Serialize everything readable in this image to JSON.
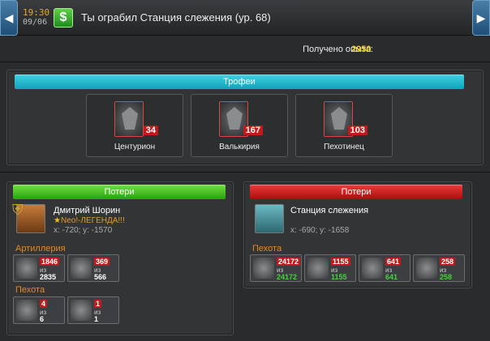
{
  "header": {
    "time": "19:30",
    "date": "09/06",
    "title": "Ты ограбил Станция слежения (ур. 68)",
    "money_icon": "$"
  },
  "experience": {
    "label": "Получено опыта:",
    "value": "2950"
  },
  "trophies": {
    "title": "Трофеи",
    "items": [
      {
        "name": "Центурион",
        "count": "34"
      },
      {
        "name": "Валькирия",
        "count": "167"
      },
      {
        "name": "Пехотинец",
        "count": "103"
      }
    ]
  },
  "left_losses": {
    "title": "Потери",
    "player_name": "Дмитрий Шорин",
    "alliance": "Neo!-ЛЕГЕНДА!!!",
    "coords": "x: -720; y: -1570",
    "sections": [
      {
        "label": "Артиллерия",
        "units": [
          {
            "lost": "1846",
            "iz": "из",
            "total": "2835"
          },
          {
            "lost": "369",
            "iz": "из",
            "total": "566"
          }
        ]
      },
      {
        "label": "Пехота",
        "units": [
          {
            "lost": "4",
            "iz": "из",
            "total": "6"
          },
          {
            "lost": "1",
            "iz": "из",
            "total": "1"
          }
        ]
      }
    ]
  },
  "right_losses": {
    "title": "Потери",
    "target_name": "Станция слежения",
    "coords": "x: -690; y: -1658",
    "sections": [
      {
        "label": "Пехота",
        "units": [
          {
            "lost": "24172",
            "iz": "из",
            "total": "24172"
          },
          {
            "lost": "1155",
            "iz": "из",
            "total": "1155"
          },
          {
            "lost": "641",
            "iz": "из",
            "total": "641"
          },
          {
            "lost": "258",
            "iz": "из",
            "total": "258"
          }
        ]
      }
    ]
  },
  "colors": {
    "accent_cyan": "#10a2b7",
    "accent_green": "#2aa012",
    "accent_red": "#a80e0e",
    "exp_value": "#f2d21d",
    "section_label": "#e58a23"
  }
}
